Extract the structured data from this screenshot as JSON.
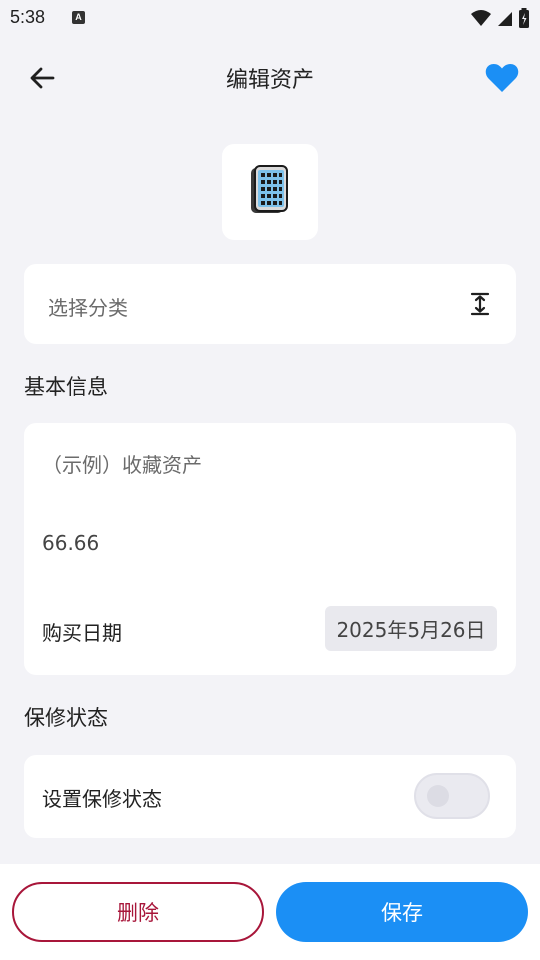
{
  "status_bar": {
    "time": "5:38",
    "notification_icon": "a-notification-icon",
    "icons": [
      "wifi-icon",
      "signal-icon",
      "battery-charging-icon"
    ]
  },
  "header": {
    "title": "编辑资产",
    "back_icon": "arrow-left-icon",
    "favorite_icon": "heart-icon",
    "favorite_active": true
  },
  "asset_icon": {
    "icon": "phone-icon"
  },
  "category": {
    "placeholder": "选择分类",
    "icon": "expand-vertical-icon"
  },
  "basic_info": {
    "section_title": "基本信息",
    "name_value": "（示例）收藏资产",
    "price_value": "66.66",
    "purchase_date_label": "购买日期",
    "purchase_date_value": "2025年5月26日"
  },
  "warranty": {
    "section_title": "保修状态",
    "toggle_label": "设置保修状态",
    "toggle_on": false
  },
  "actions": {
    "delete_label": "删除",
    "save_label": "保存"
  },
  "colors": {
    "accent": "#1b8ff5",
    "danger": "#a8163a",
    "background": "#f3f3f7"
  }
}
